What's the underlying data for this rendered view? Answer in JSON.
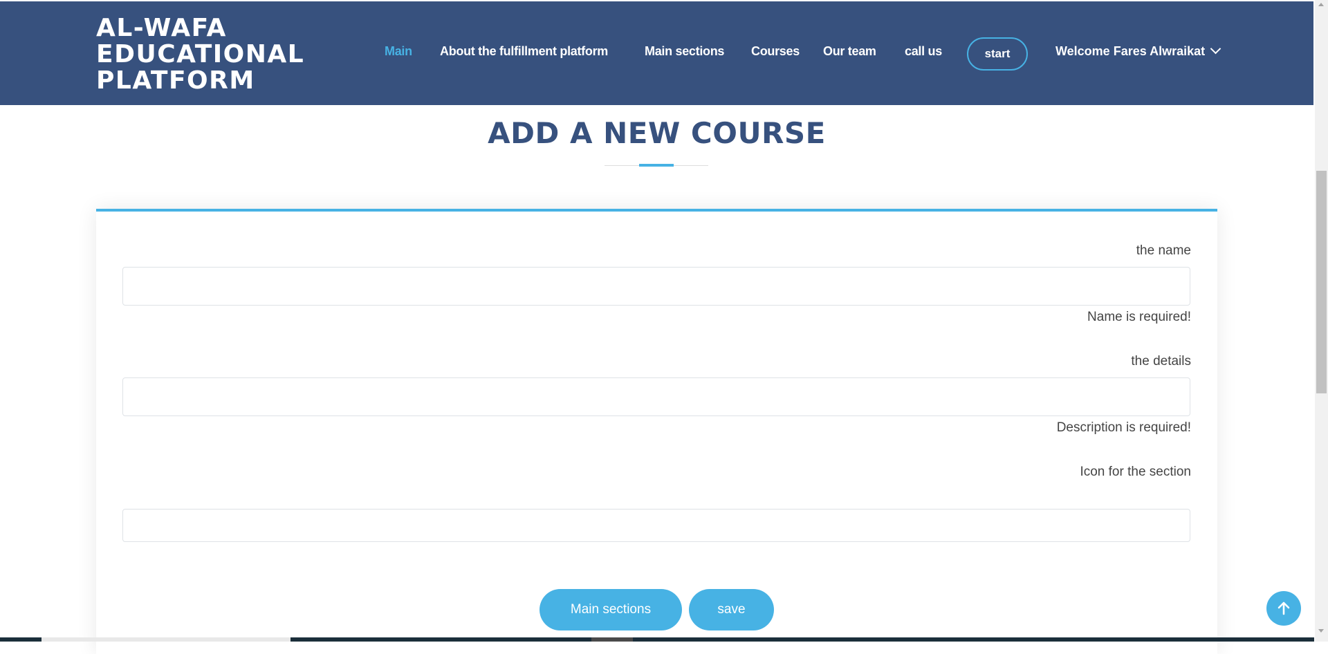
{
  "header": {
    "logo": [
      "AL-WAFA",
      "EDUCATIONAL",
      "PLATFORM"
    ],
    "nav": [
      "Main",
      "About the fulfillment platform",
      "Main sections",
      "Courses",
      "Our team",
      "call us"
    ],
    "start_label": "start",
    "welcome_label": "Welcome Fares Alwraikat",
    "active_color": "#47b2e4",
    "background_color": "#37517e"
  },
  "page": {
    "title": "ADD A NEW COURSE"
  },
  "form": {
    "name_label": "the name",
    "name_value": "",
    "name_error": "Name is required!",
    "details_label": "the details",
    "details_value": "",
    "details_error": "Description is required!",
    "icon_label": "Icon for the section",
    "icon_value": "",
    "sections_button": "Main sections",
    "save_button": "save"
  },
  "icons": {
    "back_to_top": "arrow-up-icon",
    "dropdown": "chevron-down-icon"
  }
}
